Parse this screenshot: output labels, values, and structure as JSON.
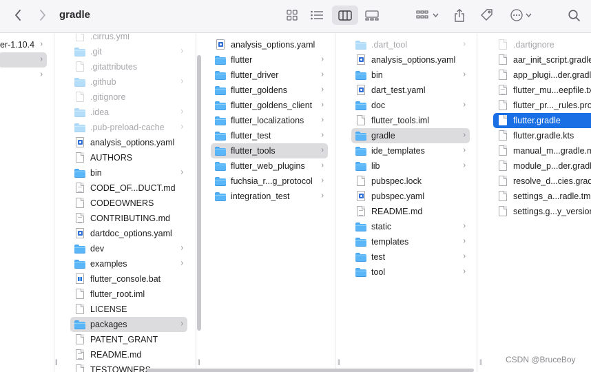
{
  "window": {
    "title": "gradle"
  },
  "toolbar": {
    "back_icon": "chevron-left-icon",
    "forward_icon": "chevron-right-icon",
    "views": [
      "icon-view-icon",
      "list-view-icon",
      "column-view-icon",
      "gallery-view-icon"
    ],
    "active_view": "column-view-icon"
  },
  "col0": {
    "items": [
      {
        "label": "er-1.10.4",
        "chevron": true
      },
      {
        "label": "",
        "chevron": true,
        "selected": true
      },
      {
        "label": "",
        "chevron": true
      }
    ]
  },
  "col1": {
    "items": [
      {
        "label": ".cirrus.yml",
        "type": "doc",
        "dim": true
      },
      {
        "label": ".git",
        "type": "folder",
        "dim": true,
        "chevron": true
      },
      {
        "label": ".gitattributes",
        "type": "doc",
        "dim": true
      },
      {
        "label": ".github",
        "type": "folder",
        "dim": true,
        "chevron": true
      },
      {
        "label": ".gitignore",
        "type": "doc",
        "dim": true
      },
      {
        "label": ".idea",
        "type": "folder",
        "dim": true,
        "chevron": true
      },
      {
        "label": ".pub-preload-cache",
        "type": "folder",
        "dim": true,
        "chevron": true
      },
      {
        "label": "analysis_options.yaml",
        "type": "yaml"
      },
      {
        "label": "AUTHORS",
        "type": "doc"
      },
      {
        "label": "bin",
        "type": "folder",
        "chevron": true
      },
      {
        "label": "CODE_OF...DUCT.md",
        "type": "doc-lines"
      },
      {
        "label": "CODEOWNERS",
        "type": "doc"
      },
      {
        "label": "CONTRIBUTING.md",
        "type": "doc-lines"
      },
      {
        "label": "dartdoc_options.yaml",
        "type": "yaml"
      },
      {
        "label": "dev",
        "type": "folder",
        "chevron": true
      },
      {
        "label": "examples",
        "type": "folder",
        "chevron": true
      },
      {
        "label": "flutter_console.bat",
        "type": "bat"
      },
      {
        "label": "flutter_root.iml",
        "type": "doc"
      },
      {
        "label": "LICENSE",
        "type": "doc"
      },
      {
        "label": "packages",
        "type": "folder",
        "chevron": true,
        "selected": true
      },
      {
        "label": "PATENT_GRANT",
        "type": "doc"
      },
      {
        "label": "README.md",
        "type": "doc-lines"
      },
      {
        "label": "TESTOWNERS",
        "type": "doc"
      }
    ]
  },
  "col2": {
    "items": [
      {
        "label": "analysis_options.yaml",
        "type": "yaml"
      },
      {
        "label": "flutter",
        "type": "folder",
        "chevron": true
      },
      {
        "label": "flutter_driver",
        "type": "folder",
        "chevron": true
      },
      {
        "label": "flutter_goldens",
        "type": "folder",
        "chevron": true
      },
      {
        "label": "flutter_goldens_client",
        "type": "folder",
        "chevron": true
      },
      {
        "label": "flutter_localizations",
        "type": "folder",
        "chevron": true
      },
      {
        "label": "flutter_test",
        "type": "folder",
        "chevron": true
      },
      {
        "label": "flutter_tools",
        "type": "folder",
        "chevron": true,
        "selected": true
      },
      {
        "label": "flutter_web_plugins",
        "type": "folder",
        "chevron": true
      },
      {
        "label": "fuchsia_r...g_protocol",
        "type": "folder",
        "chevron": true
      },
      {
        "label": "integration_test",
        "type": "folder",
        "chevron": true
      }
    ]
  },
  "col3": {
    "items": [
      {
        "label": ".dart_tool",
        "type": "folder",
        "dim": true,
        "chevron": true
      },
      {
        "label": "analysis_options.yaml",
        "type": "yaml"
      },
      {
        "label": "bin",
        "type": "folder",
        "chevron": true
      },
      {
        "label": "dart_test.yaml",
        "type": "yaml"
      },
      {
        "label": "doc",
        "type": "folder",
        "chevron": true
      },
      {
        "label": "flutter_tools.iml",
        "type": "doc"
      },
      {
        "label": "gradle",
        "type": "folder",
        "chevron": true,
        "selected": true
      },
      {
        "label": "ide_templates",
        "type": "folder",
        "chevron": true
      },
      {
        "label": "lib",
        "type": "folder",
        "chevron": true
      },
      {
        "label": "pubspec.lock",
        "type": "doc"
      },
      {
        "label": "pubspec.yaml",
        "type": "yaml"
      },
      {
        "label": "README.md",
        "type": "doc-lines"
      },
      {
        "label": "static",
        "type": "folder",
        "chevron": true
      },
      {
        "label": "templates",
        "type": "folder",
        "chevron": true
      },
      {
        "label": "test",
        "type": "folder",
        "chevron": true
      },
      {
        "label": "tool",
        "type": "folder",
        "chevron": true
      }
    ]
  },
  "col4": {
    "items": [
      {
        "label": ".dartignore",
        "type": "doc",
        "dim": true
      },
      {
        "label": "aar_init_script.gradle",
        "type": "doc"
      },
      {
        "label": "app_plugi...der.gradle",
        "type": "doc"
      },
      {
        "label": "flutter_mu...eepfile.txt",
        "type": "doc-lines"
      },
      {
        "label": "flutter_pr..._rules.pro",
        "type": "doc"
      },
      {
        "label": "flutter.gradle",
        "type": "doc",
        "active": true
      },
      {
        "label": "flutter.gradle.kts",
        "type": "doc"
      },
      {
        "label": "manual_m...gradle.md",
        "type": "doc"
      },
      {
        "label": "module_p...der.gradle",
        "type": "doc"
      },
      {
        "label": "resolve_d...cies.gradle",
        "type": "doc"
      },
      {
        "label": "settings_a...radle.tmpl",
        "type": "doc"
      },
      {
        "label": "settings.g...y_version",
        "type": "doc"
      }
    ]
  },
  "watermark": {
    "text": "CSDN @BruceBoy"
  }
}
